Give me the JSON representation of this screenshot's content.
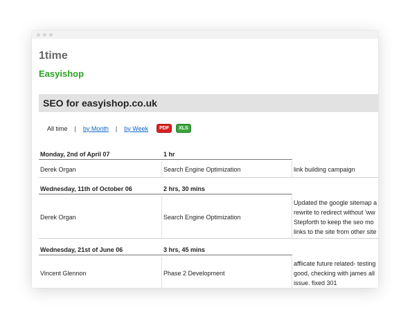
{
  "app_title": "1time",
  "client": "Easyishop",
  "section_title": "SEO for easyishop.co.uk",
  "filters": {
    "all_time": "All time",
    "separator": "|",
    "by_month": "by Month",
    "by_week": "by Week"
  },
  "exports": {
    "pdf": "PDF",
    "xls": "XLS"
  },
  "groups": [
    {
      "date": "Monday, 2nd of April 07",
      "duration": "1 hr",
      "entry": {
        "person": "Derek Organ",
        "category": "Search Engine Optimization",
        "note_lines": [
          "link building campaign"
        ]
      }
    },
    {
      "date": "Wednesday, 11th of October 06",
      "duration": "2 hrs, 30 mins",
      "entry": {
        "person": "Derek Organ",
        "category": "Search Engine Optimization",
        "note_lines": [
          "Updated the google sitemap a",
          "rewrite to redirect without 'ww",
          "Stepforth to keep the seo mo",
          "links to the site from other site"
        ]
      }
    },
    {
      "date": "Wednesday, 21st of June 06",
      "duration": "3 hrs, 45 mins",
      "entry": {
        "person": "Vincent Glennon",
        "category": "Phase 2 Development",
        "note_lines": [
          "afflicate future related- testing",
          "good, checking with james all",
          "issue. fixed 301"
        ]
      }
    }
  ],
  "colors": {
    "client_green": "#2aa321",
    "link_blue": "#0c64c8",
    "section_bg": "#e2e2e2",
    "pdf_red": "#d92020",
    "xls_green": "#3da33d"
  }
}
